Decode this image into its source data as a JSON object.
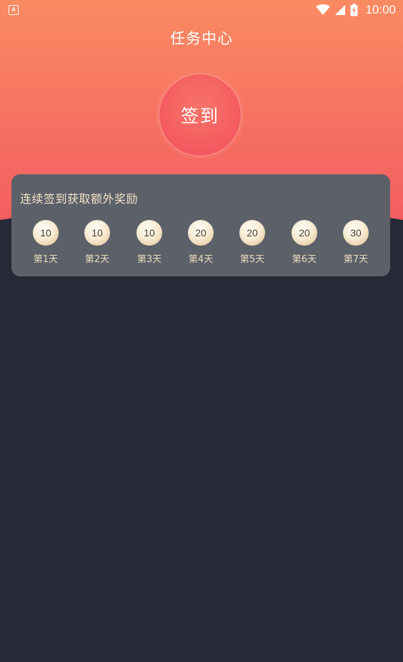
{
  "status_bar": {
    "app_icon_letter": "A",
    "time": "10:00"
  },
  "page": {
    "title": "任务中心"
  },
  "checkin": {
    "button_label": "签到"
  },
  "reward_card": {
    "title": "连续签到获取额外奖励",
    "days": [
      {
        "points": "10",
        "label": "第1天"
      },
      {
        "points": "10",
        "label": "第2天"
      },
      {
        "points": "10",
        "label": "第3天"
      },
      {
        "points": "20",
        "label": "第4天"
      },
      {
        "points": "20",
        "label": "第5天"
      },
      {
        "points": "20",
        "label": "第6天"
      },
      {
        "points": "30",
        "label": "第7天"
      }
    ]
  },
  "colors": {
    "header_gradient_top": "#fa8a62",
    "header_gradient_bottom": "#f35e62",
    "page_background": "#262a37",
    "card_background": "#5c6069",
    "card_text": "#f1e3c6"
  }
}
